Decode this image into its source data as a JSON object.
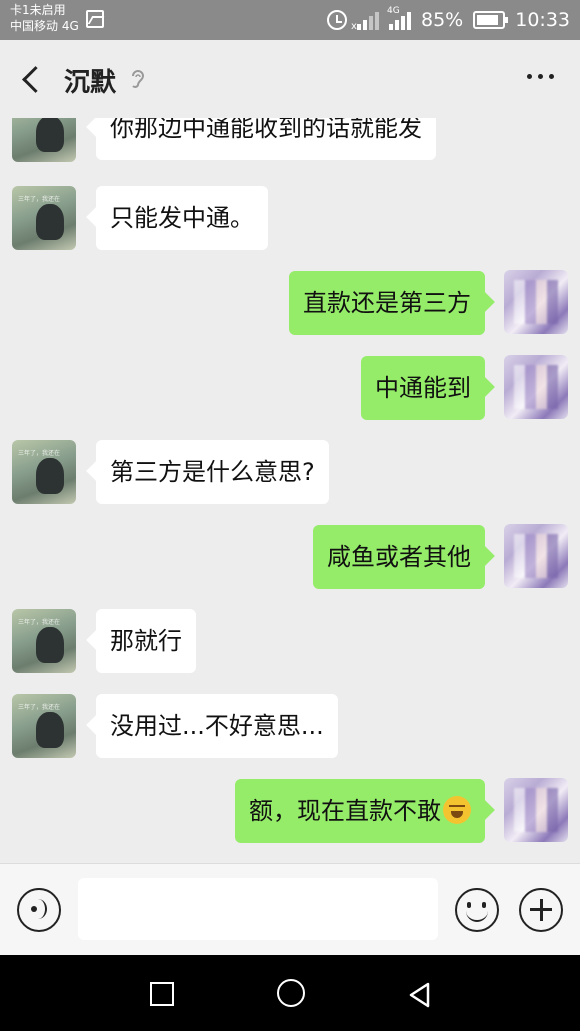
{
  "status_bar": {
    "carrier_line1": "卡1未启用",
    "carrier_line2": "中国移动 4G",
    "network": "4G",
    "battery": "85%",
    "battery_level": 0.85,
    "time": "10:33"
  },
  "header": {
    "title": "沉默"
  },
  "messages": [
    {
      "side": "left",
      "text": "你那边中通能收到的话就能发"
    },
    {
      "side": "left",
      "text": "只能发中通。"
    },
    {
      "side": "right",
      "text": "直款还是第三方"
    },
    {
      "side": "right",
      "text": "中通能到"
    },
    {
      "side": "left",
      "text": "第三方是什么意思?"
    },
    {
      "side": "right",
      "text": "咸鱼或者其他"
    },
    {
      "side": "left",
      "text": "那就行"
    },
    {
      "side": "left",
      "text": "没用过...不好意思..."
    },
    {
      "side": "right",
      "text": "额，现在直款不敢",
      "emoji": "crying-laughing-emoji"
    }
  ],
  "input_bar": {
    "value": ""
  },
  "icons": {
    "back": "back-arrow-icon",
    "ear": "ear-icon",
    "more": "more-dots-icon",
    "voice": "voice-icon",
    "emoji": "emoji-icon",
    "plus": "plus-icon"
  },
  "colors": {
    "bubble_self": "#95ec69",
    "bubble_other": "#ffffff",
    "background": "#ededed"
  }
}
